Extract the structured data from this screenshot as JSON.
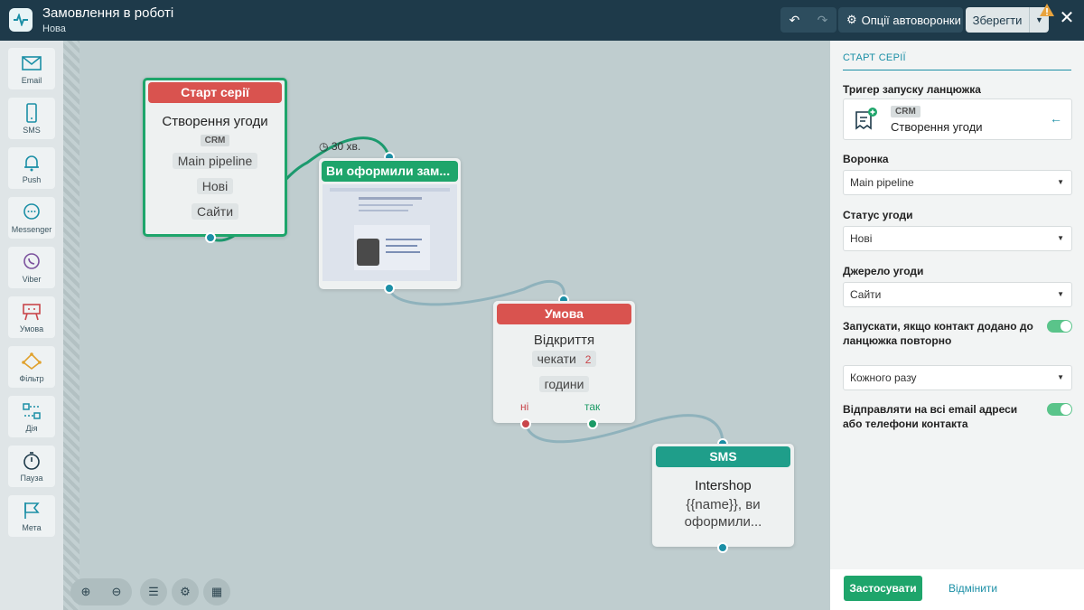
{
  "header": {
    "title": "Замовлення в роботі",
    "subtitle": "Нова",
    "options_label": "Опції автоворонки",
    "save_label": "Зберегти"
  },
  "sidebar": {
    "tools": [
      {
        "label": "Email",
        "icon": "email-icon"
      },
      {
        "label": "SMS",
        "icon": "phone-icon"
      },
      {
        "label": "Push",
        "icon": "bell-icon"
      },
      {
        "label": "Messenger",
        "icon": "chat-icon"
      },
      {
        "label": "Viber",
        "icon": "viber-icon"
      },
      {
        "label": "Умова",
        "icon": "condition-icon"
      },
      {
        "label": "Фільтр",
        "icon": "filter-icon"
      },
      {
        "label": "Дія",
        "icon": "action-icon"
      },
      {
        "label": "Пауза",
        "icon": "timer-icon"
      },
      {
        "label": "Мета",
        "icon": "flag-icon"
      }
    ]
  },
  "nodes": {
    "start": {
      "header": "Старт серії",
      "title": "Створення угоди",
      "badge": "CRM",
      "pipeline": "Main pipeline",
      "status": "Нові",
      "source": "Сайти"
    },
    "email": {
      "delay": "30 хв.",
      "header": "Ви оформили зам..."
    },
    "condition": {
      "header": "Умова",
      "event": "Відкриття",
      "wait_label": "чекати",
      "wait_value": "2",
      "unit": "години",
      "no_label": "ні",
      "yes_label": "так"
    },
    "sms": {
      "header": "SMS",
      "sender": "Intershop",
      "text": "{{name}}, ви оформили..."
    }
  },
  "panel": {
    "section_title": "СТАРТ СЕРІЇ",
    "trigger_label": "Тригер запуску ланцюжка",
    "trigger_badge": "CRM",
    "trigger_value": "Створення угоди",
    "pipeline_label": "Воронка",
    "pipeline_value": "Main pipeline",
    "status_label": "Статус угоди",
    "status_value": "Нові",
    "source_label": "Джерело угоди",
    "source_value": "Сайти",
    "repeat_label": "Запускати, якщо контакт додано до ланцюжка повторно",
    "repeat_enabled": true,
    "frequency_value": "Кожного разу",
    "all_addresses_label": "Відправляти на всі email адреси або телефони контакта",
    "all_addresses_enabled": true,
    "apply_label": "Застосувати",
    "cancel_label": "Відмінити"
  },
  "colors": {
    "topbar": "#1e3a4a",
    "start_header": "#d9534f",
    "email_header": "#1ea56b",
    "condition_header": "#d9534f",
    "sms_header": "#1f9e8a",
    "port": "#1b8fa6",
    "port_no": "#c9464b",
    "port_yes": "#1a9a65",
    "accent": "#1b8fa6"
  }
}
